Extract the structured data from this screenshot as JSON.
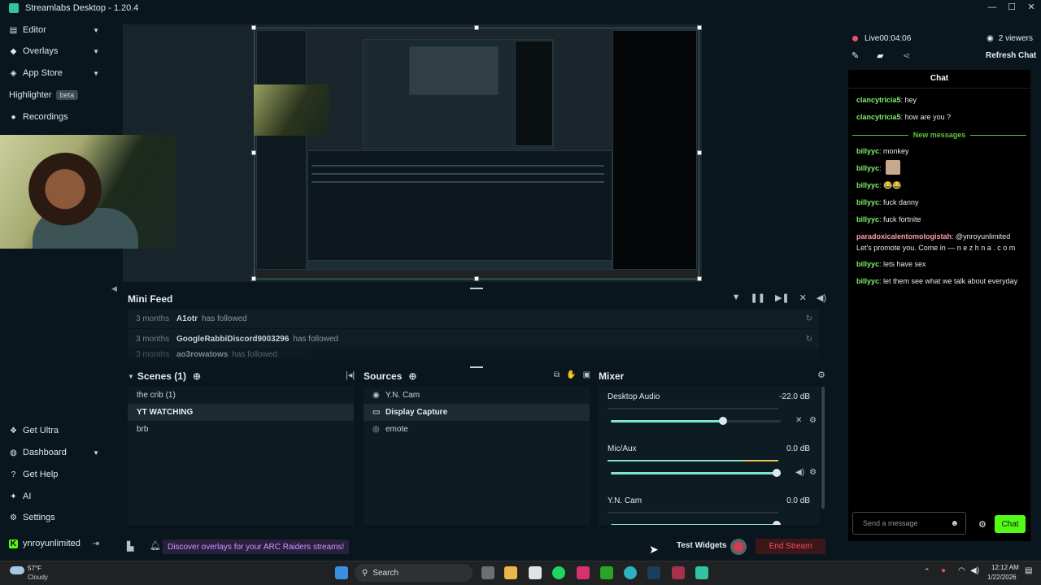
{
  "window": {
    "title": "Streamlabs Desktop - 1.20.4"
  },
  "sidebar": {
    "items": [
      {
        "label": "Editor",
        "icon": "editor-icon"
      },
      {
        "label": "Overlays",
        "icon": "overlays-icon"
      },
      {
        "label": "App Store",
        "icon": "store-icon"
      },
      {
        "label": "Highlighter",
        "icon": "highlighter-icon",
        "badge": "beta"
      },
      {
        "label": "Recordings",
        "icon": "recordings-icon"
      }
    ],
    "bottom": [
      {
        "label": "Get Ultra",
        "icon": "ultra-icon"
      },
      {
        "label": "Dashboard",
        "icon": "dashboard-icon"
      },
      {
        "label": "Get Help",
        "icon": "help-icon"
      },
      {
        "label": "AI",
        "icon": "ai-icon"
      },
      {
        "label": "Settings",
        "icon": "settings-icon"
      }
    ],
    "account": "ynroyunlimited"
  },
  "mini_feed": {
    "title": "Mini Feed",
    "rows": [
      {
        "when": "3 months",
        "who": "A1otr",
        "what": "has followed"
      },
      {
        "when": "3 months",
        "who": "GoogleRabbiDiscord9003296",
        "what": "has followed"
      },
      {
        "when": "3 months",
        "who": "ao3rowatows",
        "what": "has followed"
      }
    ]
  },
  "scenes": {
    "title": "Scenes (1)",
    "items": [
      "the crib (1)",
      "YT WATCHING",
      "brb"
    ],
    "selected": 1
  },
  "sources": {
    "title": "Sources",
    "items": [
      {
        "label": "Y.N. Cam",
        "icon": "camera-icon"
      },
      {
        "label": "Display Capture",
        "icon": "monitor-icon"
      },
      {
        "label": "emote",
        "icon": "globe-icon"
      }
    ],
    "selected": 1
  },
  "mixer": {
    "title": "Mixer",
    "channels": [
      {
        "name": "Desktop Audio",
        "db": "-22.0 dB",
        "level": 0.66
      },
      {
        "name": "Mic/Aux",
        "db": "0.0 dB",
        "level": 1.0
      },
      {
        "name": "Y.N. Cam",
        "db": "0.0 dB",
        "level": 1.0
      }
    ]
  },
  "footer": {
    "promo": "Discover overlays for your ARC Raiders streams!",
    "test_widgets": "Test Widgets",
    "end_stream": "End Stream"
  },
  "live": {
    "status": "Live",
    "time": "00:04:06",
    "viewers": "2 viewers",
    "refresh_chat": "Refresh Chat"
  },
  "chat": {
    "title": "Chat",
    "new_messages": "New messages",
    "messages_before": [
      {
        "user": "clancytricia5",
        "text": ": hey",
        "color": "#7cf26a"
      },
      {
        "user": "clancytricia5",
        "text": ": how are you ?",
        "color": "#7cf26a"
      }
    ],
    "messages_after": [
      {
        "user": "billyyc",
        "text": ": monkey",
        "color": "#7cf26a"
      },
      {
        "user": "billyyc",
        "text": ":",
        "color": "#7cf26a"
      },
      {
        "user": "billyyc",
        "text": ": 😂😂",
        "color": "#7cf26a"
      },
      {
        "user": "billyyc",
        "text": ": fuck danny",
        "color": "#7cf26a"
      },
      {
        "user": "billyyc",
        "text": ": fuck fortnite",
        "color": "#7cf26a"
      },
      {
        "user": "paradoxicalentomologistah",
        "text": ": @ynroyunlimited Let's promote you. Come in — n e z h n a . c o m",
        "color": "#ff9db0"
      },
      {
        "user": "billyyc",
        "text": ": lets have sex",
        "color": "#7cf26a"
      },
      {
        "user": "billyyc",
        "text": ": let them see what we talk about everyday",
        "color": "#7cf26a"
      }
    ],
    "input_placeholder": "Send a message",
    "send_label": "Chat"
  },
  "taskbar": {
    "weather_temp": "57°F",
    "weather_text": "Cloudy",
    "search": "Search",
    "time": "12:12 AM",
    "date": "1/22/2026"
  }
}
